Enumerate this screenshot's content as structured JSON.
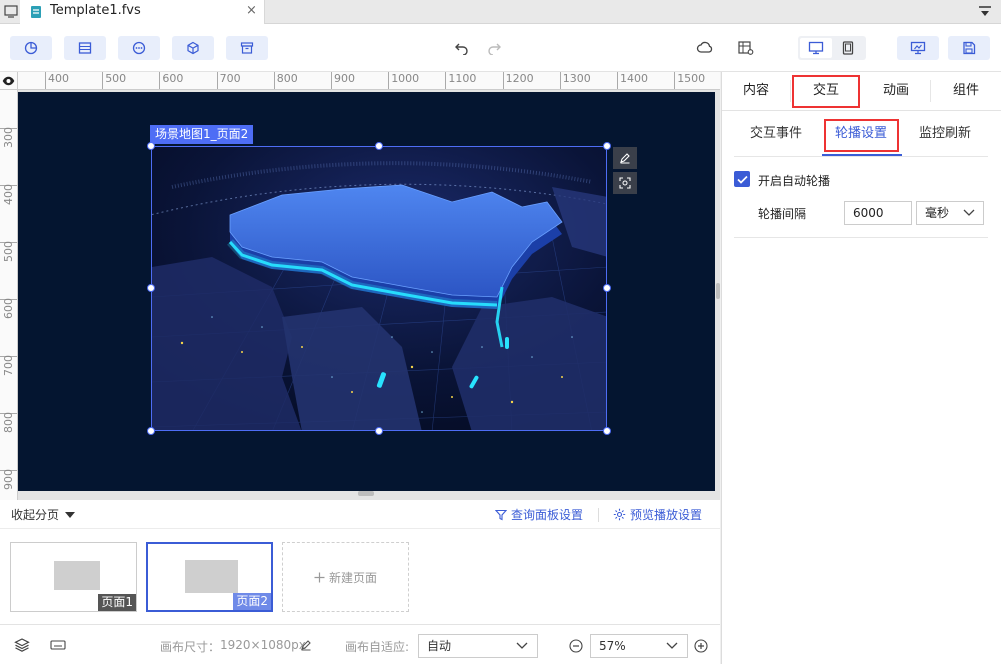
{
  "tabbar": {
    "title": "Template1.fvs",
    "close": "×"
  },
  "ruler": {
    "top": [
      "400",
      "500",
      "600",
      "700",
      "800",
      "900",
      "1000",
      "1100",
      "1200",
      "1300",
      "1400",
      "1500"
    ],
    "left": [
      "300",
      "400",
      "500",
      "600",
      "700",
      "800",
      "900"
    ]
  },
  "canvas": {
    "widget_label": "场景地图1_页面2",
    "background": "#041530",
    "selection_color": "#4e6df5"
  },
  "pages": {
    "collapse": "收起分页",
    "query_settings": "查询面板设置",
    "preview_settings": "预览播放设置",
    "items": [
      {
        "tag": "页面1",
        "selected": false
      },
      {
        "tag": "页面2",
        "selected": true
      }
    ],
    "new_page": "新建页面"
  },
  "status": {
    "canvas_size_label": "画布尺寸：",
    "canvas_size_value": "1920×1080px",
    "fit_label": "画布自适应:",
    "fit_value": "自动",
    "zoom": "57%"
  },
  "right_panel": {
    "tabs": [
      "内容",
      "交互",
      "动画",
      "组件"
    ],
    "active_tab": "交互",
    "sub_tabs": [
      "交互事件",
      "轮播设置",
      "监控刷新"
    ],
    "active_sub_tab": "轮播设置",
    "auto_play_label": "开启自动轮播",
    "auto_play_checked": true,
    "interval_label": "轮播间隔",
    "interval_value": "6000",
    "interval_unit": "毫秒",
    "accent": "#3b5cd6",
    "highlight": "#e33333"
  }
}
